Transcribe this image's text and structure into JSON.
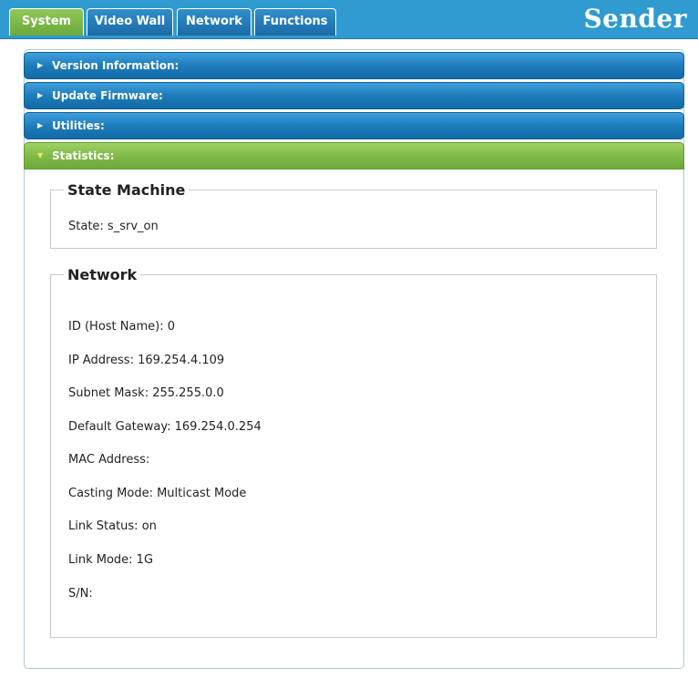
{
  "tabs": [
    {
      "label": "System",
      "active": true
    },
    {
      "label": "Video Wall"
    },
    {
      "label": "Network"
    },
    {
      "label": "Functions"
    }
  ],
  "brand": "Sender",
  "accordion": [
    {
      "label": "Version Information:"
    },
    {
      "label": "Update Firmware:"
    },
    {
      "label": "Utilities:"
    },
    {
      "label": "Statistics:",
      "open": true
    }
  ],
  "state_machine": {
    "title": "State Machine",
    "state": "State: s_srv_on"
  },
  "network": {
    "title": "Network",
    "lines": [
      "ID (Host Name): 0",
      "IP Address: 169.254.4.109",
      "Subnet Mask: 255.255.0.0",
      "Default Gateway: 169.254.0.254",
      "MAC Address:",
      "Casting Mode: Multicast Mode",
      "Link Status: on",
      "Link Mode: 1G",
      "S/N:"
    ]
  },
  "colors": {
    "topbar": "#2f9bd1",
    "active_green": "#80bb48",
    "accordion_blue": "#1e7cbc"
  },
  "icons": {
    "collapsed": "triangle-right-icon",
    "expanded": "triangle-down-icon"
  }
}
